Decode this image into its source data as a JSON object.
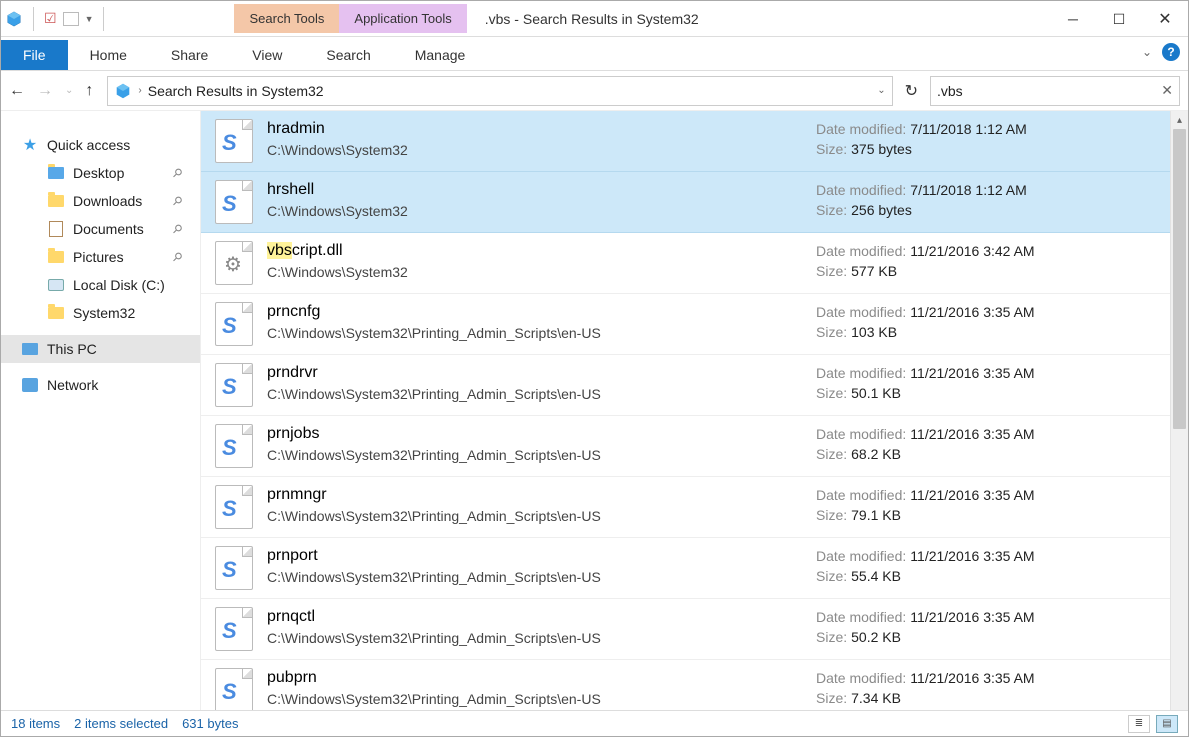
{
  "title": ".vbs - Search Results in System32",
  "context_tabs": {
    "search": "Search Tools",
    "app": "Application Tools"
  },
  "ribbon": {
    "file": "File",
    "home": "Home",
    "share": "Share",
    "view": "View",
    "search": "Search",
    "manage": "Manage"
  },
  "nav": {
    "address": "Search Results in System32"
  },
  "searchbox": {
    "query": ".vbs"
  },
  "sidebar": {
    "quick_access": "Quick access",
    "desktop": "Desktop",
    "downloads": "Downloads",
    "documents": "Documents",
    "pictures": "Pictures",
    "localc": "Local Disk (C:)",
    "system32": "System32",
    "thispc": "This PC",
    "network": "Network"
  },
  "results": [
    {
      "name": "hradmin",
      "path": "C:\\Windows\\System32",
      "date": "7/11/2018 1:12 AM",
      "size": "375 bytes",
      "icon": "vbs",
      "selected": true
    },
    {
      "name": "hrshell",
      "path": "C:\\Windows\\System32",
      "date": "7/11/2018 1:12 AM",
      "size": "256 bytes",
      "icon": "vbs",
      "selected": true
    },
    {
      "name": "vbscript.dll",
      "path": "C:\\Windows\\System32",
      "date": "11/21/2016 3:42 AM",
      "size": "577 KB",
      "icon": "dll",
      "highlight": "vbs"
    },
    {
      "name": "prncnfg",
      "path": "C:\\Windows\\System32\\Printing_Admin_Scripts\\en-US",
      "date": "11/21/2016 3:35 AM",
      "size": "103 KB",
      "icon": "vbs"
    },
    {
      "name": "prndrvr",
      "path": "C:\\Windows\\System32\\Printing_Admin_Scripts\\en-US",
      "date": "11/21/2016 3:35 AM",
      "size": "50.1 KB",
      "icon": "vbs"
    },
    {
      "name": "prnjobs",
      "path": "C:\\Windows\\System32\\Printing_Admin_Scripts\\en-US",
      "date": "11/21/2016 3:35 AM",
      "size": "68.2 KB",
      "icon": "vbs"
    },
    {
      "name": "prnmngr",
      "path": "C:\\Windows\\System32\\Printing_Admin_Scripts\\en-US",
      "date": "11/21/2016 3:35 AM",
      "size": "79.1 KB",
      "icon": "vbs"
    },
    {
      "name": "prnport",
      "path": "C:\\Windows\\System32\\Printing_Admin_Scripts\\en-US",
      "date": "11/21/2016 3:35 AM",
      "size": "55.4 KB",
      "icon": "vbs"
    },
    {
      "name": "prnqctl",
      "path": "C:\\Windows\\System32\\Printing_Admin_Scripts\\en-US",
      "date": "11/21/2016 3:35 AM",
      "size": "50.2 KB",
      "icon": "vbs"
    },
    {
      "name": "pubprn",
      "path": "C:\\Windows\\System32\\Printing_Admin_Scripts\\en-US",
      "date": "11/21/2016 3:35 AM",
      "size": "7.34 KB",
      "icon": "vbs"
    }
  ],
  "labels": {
    "date_modified": "Date modified:",
    "size": "Size:"
  },
  "status": {
    "count": "18 items",
    "selected": "2 items selected",
    "bytes": "631 bytes"
  }
}
